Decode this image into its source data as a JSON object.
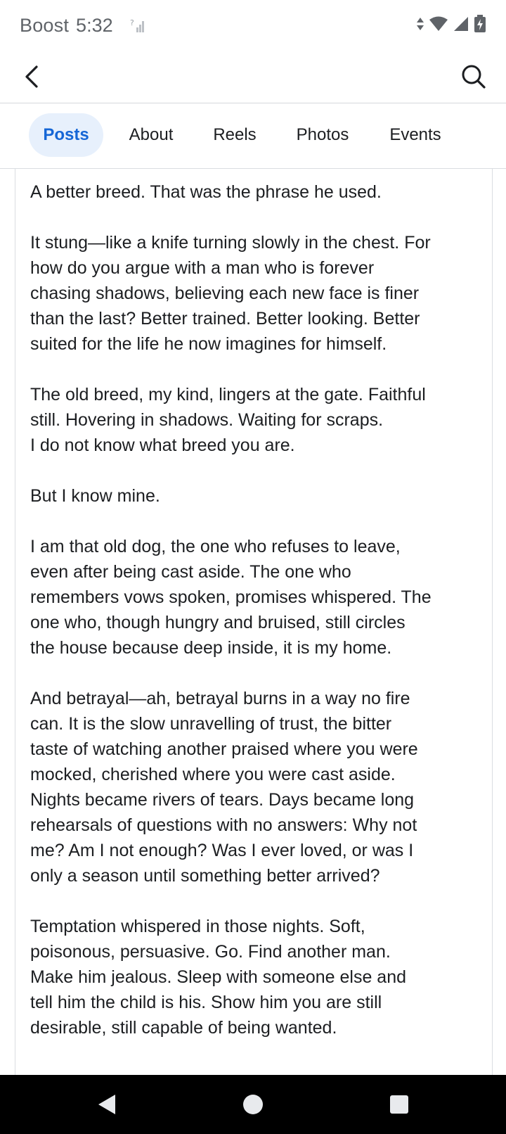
{
  "status_bar": {
    "carrier": "Boost",
    "time": "5:32",
    "small_signal_mark": "?",
    "icons": [
      "data-arrows-icon",
      "wifi-icon",
      "cell-signal-icon",
      "battery-charging-icon"
    ]
  },
  "app_bar": {
    "icons": [
      "back-icon",
      "search-icon"
    ]
  },
  "tabs": [
    {
      "label": "Posts",
      "active": true
    },
    {
      "label": "About",
      "active": false
    },
    {
      "label": "Reels",
      "active": false
    },
    {
      "label": "Photos",
      "active": false
    },
    {
      "label": "Events",
      "active": false
    }
  ],
  "post": {
    "paragraphs": [
      [
        "A better breed. That was the phrase he used."
      ],
      [
        "It stung—like a knife turning slowly in the chest. For",
        "how do you argue with a man who is forever",
        "chasing shadows, believing each new face is finer",
        "than the last? Better trained. Better looking. Better",
        "suited for the life he now imagines for himself."
      ],
      [
        "The old breed, my kind, lingers at the gate. Faithful",
        "still. Hovering in shadows. Waiting for scraps.",
        "I do not know what breed you are."
      ],
      [
        "But I know mine."
      ],
      [
        "I am that old dog, the one who refuses to leave,",
        "even after being cast aside. The one who",
        "remembers vows spoken, promises whispered. The",
        "one who, though hungry and bruised, still circles",
        "the house because deep inside, it is my home."
      ],
      [
        "And betrayal—ah, betrayal burns in a way no fire",
        "can. It is the slow unravelling of trust, the bitter",
        "taste of watching another praised where you were",
        "mocked, cherished where you were cast aside.",
        "Nights became rivers of tears. Days became long",
        "rehearsals of questions with no answers: Why not",
        "me? Am I not enough? Was I ever loved, or was I",
        "only a season until something better arrived?"
      ],
      [
        "Temptation whispered in those nights. Soft,",
        "poisonous, persuasive. Go. Find another man.",
        "Make him jealous. Sleep with someone else and",
        "tell him the child is his. Show him you are still",
        "desirable, still capable of being wanted."
      ]
    ]
  },
  "nav_bar": {
    "icons": [
      "nav-back-icon",
      "nav-home-icon",
      "nav-recents-icon"
    ]
  },
  "colors": {
    "accent": "#1566d6",
    "active_tab_bg": "#e7f0fc",
    "text": "#1c1e21",
    "divider": "#dadde1"
  }
}
